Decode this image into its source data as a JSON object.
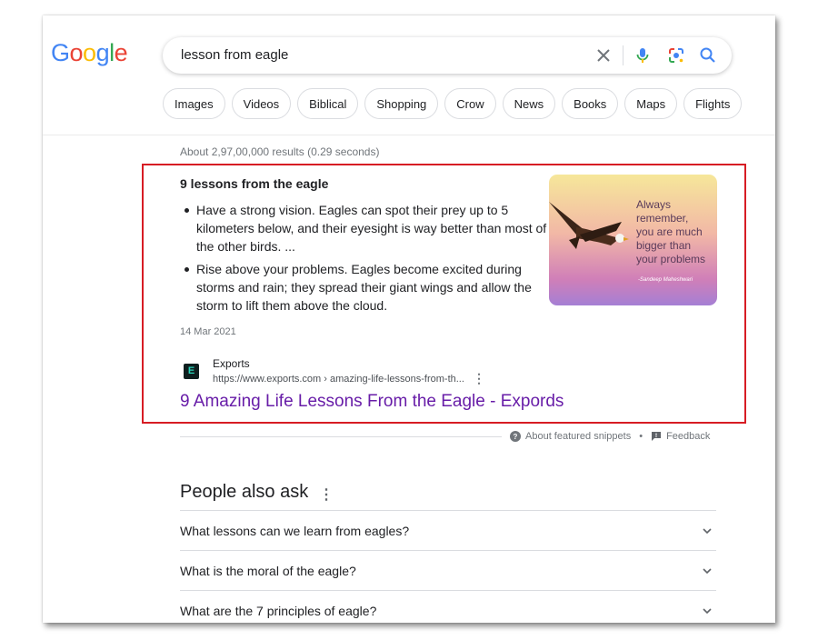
{
  "logo": {
    "letters": [
      "G",
      "o",
      "o",
      "g",
      "l",
      "e"
    ],
    "colors": [
      "#4285F4",
      "#EA4335",
      "#FBBC05",
      "#4285F4",
      "#34A853",
      "#EA4335"
    ]
  },
  "search": {
    "query": "lesson from eagle"
  },
  "chips": [
    "Images",
    "Videos",
    "Biblical",
    "Shopping",
    "Crow",
    "News",
    "Books",
    "Maps",
    "Flights"
  ],
  "stats": "About 2,97,00,000 results (0.29 seconds)",
  "featured_snippet": {
    "title": "9 lessons from the eagle",
    "bullets": [
      "Have a strong vision. Eagles can spot their prey up to 5 kilometers below, and their eyesight is way better than most of the other birds. ...",
      "Rise above your problems. Eagles become excited during storms and rain; they spread their giant wings and allow the storm to lift them above the cloud."
    ],
    "date": "14 Mar 2021",
    "image": {
      "quote_lines": [
        "Always",
        "remember,",
        "you are much",
        "bigger than",
        "your problems"
      ],
      "author": "-Sandeep Maheshwari"
    },
    "source": {
      "favicon_letter": "E",
      "name": "Exports",
      "url": "https://www.exports.com › amazing-life-lessons-from-th...",
      "more_icon": "⋮"
    },
    "link_title": "9 Amazing Life Lessons From the Eagle - Expords",
    "footer": {
      "about": "About featured snippets",
      "separator": "•",
      "feedback": "Feedback"
    }
  },
  "people_also_ask": {
    "title": "People also ask",
    "more_icon": "⋮",
    "questions": [
      "What lessons can we learn from eagles?",
      "What is the moral of the eagle?",
      "What are the 7 principles of eagle?"
    ]
  },
  "accent_colors": {
    "highlight_border": "#d71c24",
    "visited_link": "#681da8"
  }
}
